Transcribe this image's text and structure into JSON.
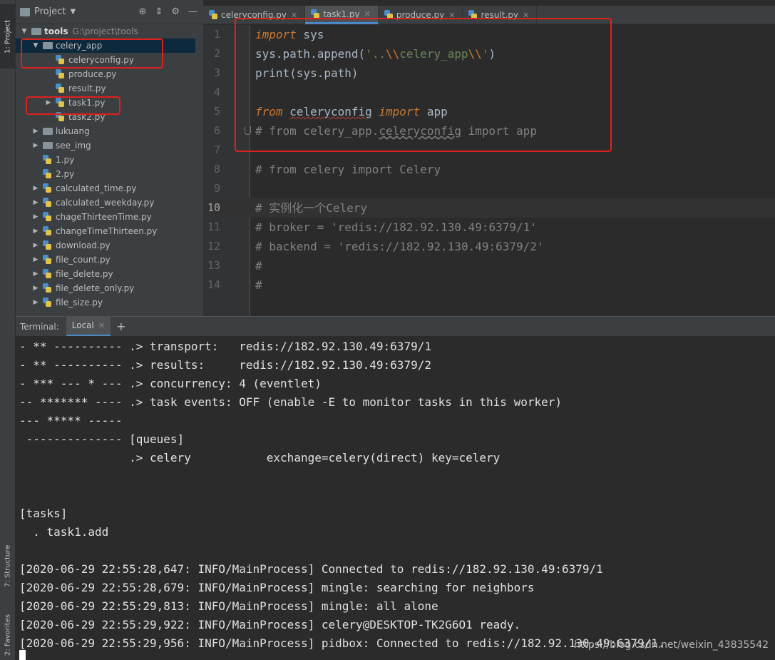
{
  "sidebar_tabs": {
    "project": "1: Project",
    "structure": "7: Structure",
    "favorites": "2: Favorites"
  },
  "project_panel": {
    "title": "Project",
    "tree": [
      {
        "label": "tools",
        "path": "G:\\project\\tools",
        "kind": "folder",
        "depth": 0,
        "expanded": true
      },
      {
        "label": "celery_app",
        "kind": "folder",
        "depth": 1,
        "expanded": true,
        "selected": true
      },
      {
        "label": "celeryconfig.py",
        "kind": "py",
        "depth": 2
      },
      {
        "label": "produce.py",
        "kind": "py",
        "depth": 2
      },
      {
        "label": "result.py",
        "kind": "py",
        "depth": 2
      },
      {
        "label": "task1.py",
        "kind": "py",
        "depth": 2,
        "collapsed": true
      },
      {
        "label": "task2.py",
        "kind": "py",
        "depth": 2
      },
      {
        "label": "lukuang",
        "kind": "folder",
        "depth": 1,
        "collapsed": true
      },
      {
        "label": "see_img",
        "kind": "folder",
        "depth": 1,
        "collapsed": true
      },
      {
        "label": "1.py",
        "kind": "py",
        "depth": 1
      },
      {
        "label": "2.py",
        "kind": "py",
        "depth": 1
      },
      {
        "label": "calculated_time.py",
        "kind": "py",
        "depth": 1,
        "collapsed": true
      },
      {
        "label": "calculated_weekday.py",
        "kind": "py",
        "depth": 1,
        "collapsed": true
      },
      {
        "label": "chageThirteenTime.py",
        "kind": "py",
        "depth": 1,
        "collapsed": true
      },
      {
        "label": "changeTimeThirteen.py",
        "kind": "py",
        "depth": 1,
        "collapsed": true
      },
      {
        "label": "download.py",
        "kind": "py",
        "depth": 1,
        "collapsed": true
      },
      {
        "label": "file_count.py",
        "kind": "py",
        "depth": 1,
        "collapsed": true
      },
      {
        "label": "file_delete.py",
        "kind": "py",
        "depth": 1,
        "collapsed": true
      },
      {
        "label": "file_delete_only.py",
        "kind": "py",
        "depth": 1,
        "collapsed": true
      },
      {
        "label": "file_size.py",
        "kind": "py",
        "depth": 1,
        "collapsed": true
      }
    ]
  },
  "editor": {
    "tabs": [
      {
        "label": "celeryconfig.py",
        "active": false
      },
      {
        "label": "task1.py",
        "active": true
      },
      {
        "label": "produce.py",
        "active": false
      },
      {
        "label": "result.py",
        "active": false
      }
    ],
    "current_line": 10,
    "lines": [
      {
        "n": "1",
        "text": "import sys"
      },
      {
        "n": "2",
        "text": "sys.path.append('..\\\\celery_app\\\\')"
      },
      {
        "n": "3",
        "text": "print(sys.path)"
      },
      {
        "n": "4",
        "text": ""
      },
      {
        "n": "5",
        "text": "from celeryconfig import app"
      },
      {
        "n": "6",
        "text": "# from celery_app.celeryconfig import app"
      },
      {
        "n": "7",
        "text": ""
      },
      {
        "n": "8",
        "text": "# from celery import Celery"
      },
      {
        "n": "9",
        "text": ""
      },
      {
        "n": "10",
        "text": "# 实例化一个Celery"
      },
      {
        "n": "11",
        "text": "# broker = 'redis://182.92.130.49:6379/1'"
      },
      {
        "n": "12",
        "text": "# backend = 'redis://182.92.130.49:6379/2'"
      },
      {
        "n": "13",
        "text": "#"
      },
      {
        "n": "14",
        "text": "#"
      }
    ]
  },
  "terminal": {
    "title": "Terminal:",
    "tab_label": "Local",
    "add_label": "+",
    "lines": [
      "- ** ---------- .> transport:   redis://182.92.130.49:6379/1",
      "- ** ---------- .> results:     redis://182.92.130.49:6379/2",
      "- *** --- * --- .> concurrency: 4 (eventlet)",
      "-- ******* ---- .> task events: OFF (enable -E to monitor tasks in this worker)",
      "--- ***** -----",
      " -------------- [queues]",
      "                .> celery           exchange=celery(direct) key=celery",
      "",
      "",
      "[tasks]",
      "  . task1.add",
      "",
      "[2020-06-29 22:55:28,647: INFO/MainProcess] Connected to redis://182.92.130.49:6379/1",
      "[2020-06-29 22:55:28,679: INFO/MainProcess] mingle: searching for neighbors",
      "[2020-06-29 22:55:29,813: INFO/MainProcess] mingle: all alone",
      "[2020-06-29 22:55:29,922: INFO/MainProcess] celery@DESKTOP-TK2G6O1 ready.",
      "[2020-06-29 22:55:29,956: INFO/MainProcess] pidbox: Connected to redis://182.92.130.49:6379/1."
    ]
  },
  "watermark": "https://blog.csdn.net/weixin_43835542",
  "colors": {
    "background": "#2b2b2b",
    "panel": "#3c3f41",
    "keyword": "#cc7832",
    "string": "#6a8759",
    "comment": "#808080",
    "annotation": "#e0201c",
    "tab_underline": "#4a88c7"
  }
}
